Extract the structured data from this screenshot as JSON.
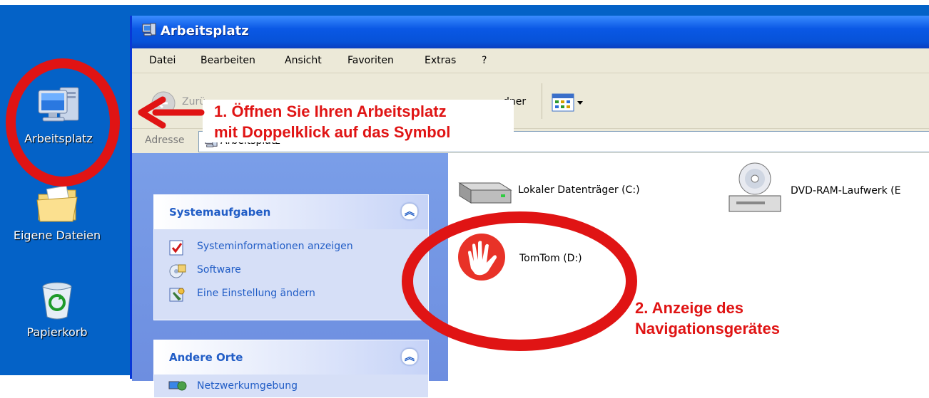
{
  "desktop": {
    "icons": [
      {
        "label": "Arbeitsplatz",
        "icon": "my-computer-icon"
      },
      {
        "label": "Eigene Dateien",
        "icon": "my-documents-icon"
      },
      {
        "label": "Papierkorb",
        "icon": "recycle-bin-icon"
      }
    ]
  },
  "window": {
    "title": "Arbeitsplatz",
    "menu": [
      "Datei",
      "Bearbeiten",
      "Ansicht",
      "Favoriten",
      "Extras",
      "?"
    ],
    "toolbar": {
      "back_label": "Zurü",
      "folders_label": "dner",
      "view_icon": "views-icon"
    },
    "address": {
      "label": "Adresse",
      "value": "Arbeitsplatz"
    },
    "taskpane": {
      "system_tasks": {
        "title": "Systemaufgaben",
        "items": [
          "Systeminformationen anzeigen",
          "Software",
          "Eine Einstellung ändern"
        ]
      },
      "other_places": {
        "title": "Andere Orte",
        "items": [
          "Netzwerkumgebung"
        ]
      }
    },
    "drives": [
      {
        "label": "Lokaler Datenträger (C:)",
        "icon": "hard-drive-icon"
      },
      {
        "label": "DVD-RAM-Laufwerk (E",
        "icon": "dvd-drive-icon"
      },
      {
        "label": "TomTom (D:)",
        "icon": "tomtom-icon"
      }
    ]
  },
  "annotations": {
    "step1": [
      "1. Öffnen Sie Ihren Arbeitsplatz",
      "mit Doppelklick auf das Symbol"
    ],
    "step2": [
      "2. Anzeige des",
      "Navigationsgerätes"
    ],
    "color": "#e01414"
  }
}
